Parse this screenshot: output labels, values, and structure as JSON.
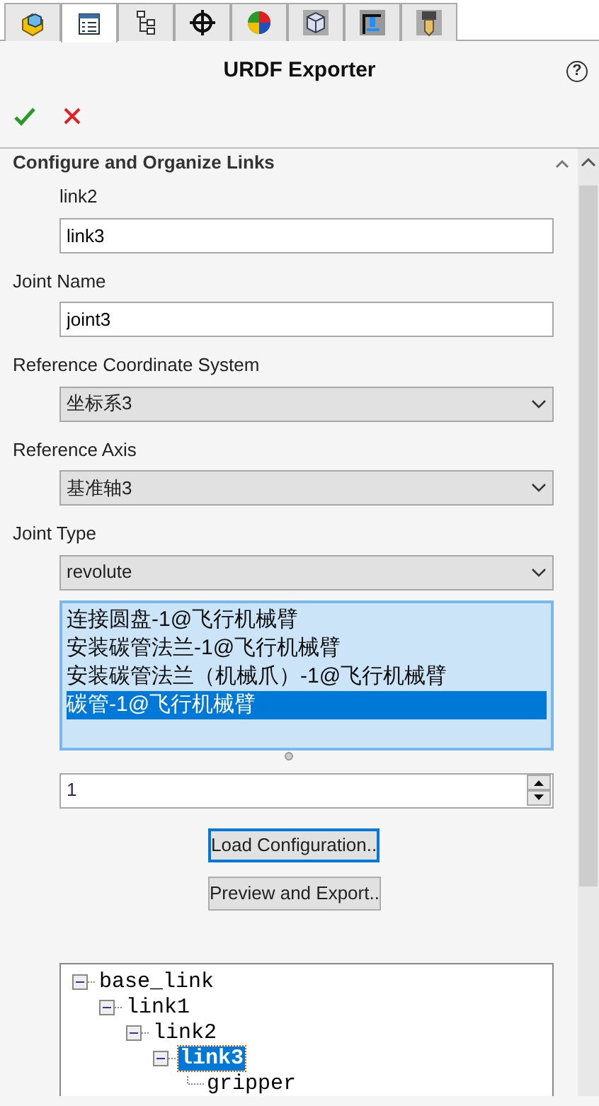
{
  "tabs": [
    {
      "kind": "part",
      "selected": false
    },
    {
      "kind": "properties",
      "selected": true
    },
    {
      "kind": "config",
      "selected": false
    },
    {
      "kind": "target",
      "selected": false
    },
    {
      "kind": "appearance",
      "selected": false
    },
    {
      "kind": "view",
      "selected": false
    },
    {
      "kind": "press",
      "selected": false
    },
    {
      "kind": "tool",
      "selected": false
    }
  ],
  "title": "URDF Exporter",
  "help": "?",
  "section": {
    "title": "Configure and Organize Links",
    "expanded": true
  },
  "parent_link": "link2",
  "link_name": {
    "value": "link3"
  },
  "joint_name": {
    "label": "Joint Name",
    "value": "joint3"
  },
  "selects": [
    {
      "label": "Reference Coordinate System",
      "value": "坐标系3"
    },
    {
      "label": "Reference Axis",
      "value": "基准轴3"
    },
    {
      "label": "Joint Type",
      "value": "revolute"
    }
  ],
  "components": [
    {
      "text": "连接圆盘-1@飞行机械臂",
      "selected": false
    },
    {
      "text": "安装碳管法兰-1@飞行机械臂",
      "selected": false
    },
    {
      "text": "安装碳管法兰（机械爪）-1@飞行机械臂",
      "selected": false
    },
    {
      "text": "碳管-1@飞行机械臂",
      "selected": true
    }
  ],
  "child_count": {
    "value": "1"
  },
  "buttons": [
    {
      "label": "Load Configuration..",
      "focused": true
    },
    {
      "label": "Preview and Export..",
      "focused": false
    }
  ],
  "tree": [
    {
      "label": "base_link",
      "expanded": true,
      "selected": false,
      "children": [
        {
          "label": "link1",
          "expanded": true,
          "selected": false,
          "children": [
            {
              "label": "link2",
              "expanded": true,
              "selected": false,
              "children": [
                {
                  "label": "link3",
                  "expanded": true,
                  "selected": true,
                  "children": [
                    {
                      "label": "gripper",
                      "selected": false
                    }
                  ]
                }
              ]
            }
          ]
        }
      ]
    }
  ]
}
